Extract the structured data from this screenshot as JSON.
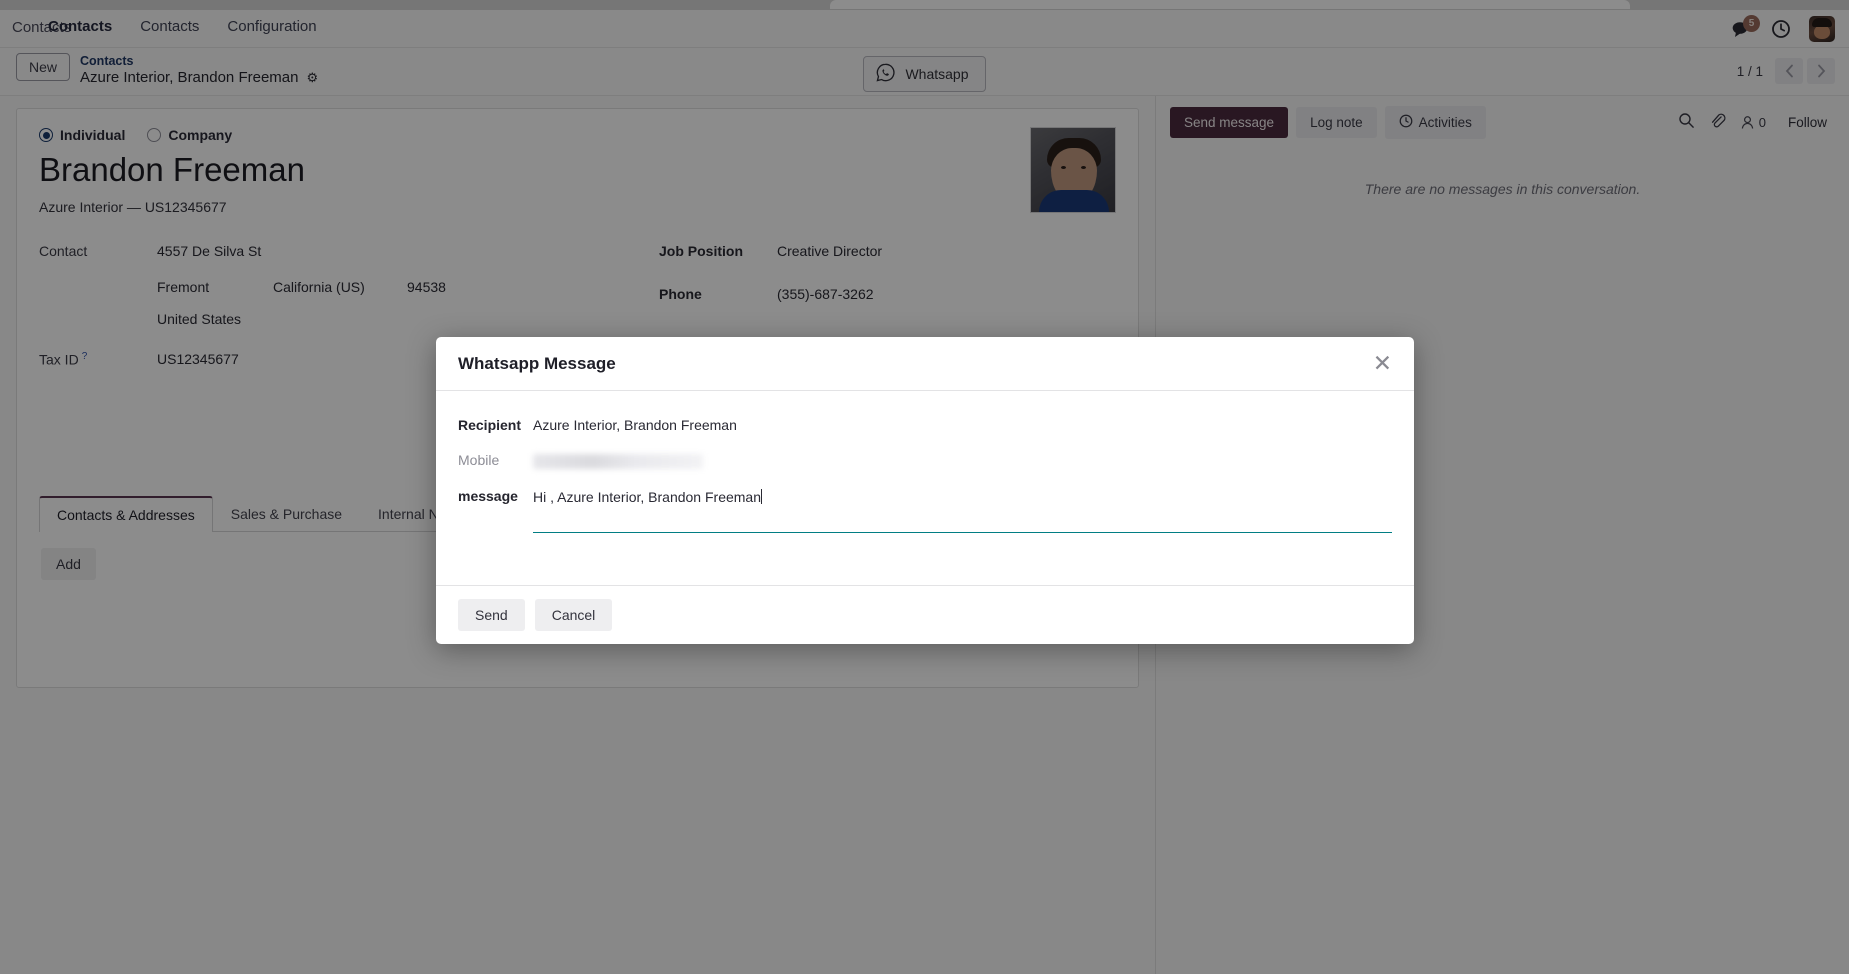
{
  "navbar": {
    "brand": "Contacts",
    "menu": [
      {
        "label": "Contacts",
        "name": "nav-item-contacts-app"
      },
      {
        "label": "Contacts",
        "name": "nav-item-contacts"
      },
      {
        "label": "Configuration",
        "name": "nav-item-configuration"
      }
    ],
    "messages_badge": "5"
  },
  "control_panel": {
    "new_label": "New",
    "breadcrumb_root": "Contacts",
    "breadcrumb_current": "Azure Interior, Brandon Freeman",
    "whatsapp_label": "Whatsapp",
    "pager": "1 / 1"
  },
  "form": {
    "type_individual": "Individual",
    "type_company": "Company",
    "record_name": "Brandon Freeman",
    "record_subtitle": "Azure Interior — US12345677",
    "labels": {
      "contact": "Contact",
      "tax_id": "Tax ID",
      "job_position": "Job Position",
      "phone": "Phone"
    },
    "address": {
      "street": "4557 De Silva St",
      "city": "Fremont",
      "state": "California (US)",
      "zip": "94538",
      "country": "United States"
    },
    "tax_id": "US12345677",
    "job_position": "Creative Director",
    "phone": "(355)-687-3262",
    "tabs": [
      {
        "label": "Contacts & Addresses",
        "active": true
      },
      {
        "label": "Sales & Purchase",
        "active": false
      },
      {
        "label": "Internal Notes",
        "active": false
      }
    ],
    "add_label": "Add"
  },
  "chatter": {
    "send_message": "Send message",
    "log_note": "Log note",
    "activities": "Activities",
    "follower_count": "0",
    "follow_label": "Follow",
    "empty_text": "There are no messages in this conversation."
  },
  "modal": {
    "title": "Whatsapp Message",
    "close_label": "✕",
    "labels": {
      "recipient": "Recipient",
      "mobile": "Mobile",
      "message": "message"
    },
    "recipient": "Azure Interior, Brandon Freeman",
    "mobile_value": "",
    "message": "Hi , Azure Interior, Brandon Freeman",
    "send_label": "Send",
    "cancel_label": "Cancel"
  },
  "colors": {
    "accent_focus": "#017E84",
    "chatter_active": "#4C2B3F",
    "link": "#1F3864",
    "badge": "#9A6A5C"
  }
}
